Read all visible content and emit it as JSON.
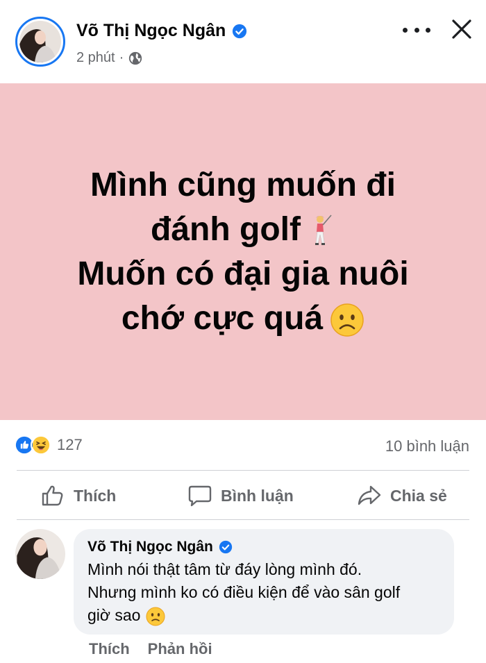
{
  "post": {
    "author": "Võ Thị Ngọc Ngân",
    "time": "2 phút",
    "separator": "·",
    "lines": [
      "Mình cũng muốn đi",
      "đánh golf",
      "Muốn có đại gia nuôi",
      "chớ cực quá"
    ],
    "background_color": "#f3c5c8"
  },
  "stats": {
    "reaction_count": "127",
    "comment_count": "10 bình luận"
  },
  "actions": {
    "like": "Thích",
    "comment": "Bình luận",
    "share": "Chia sẻ"
  },
  "comment": {
    "author": "Võ Thị Ngọc Ngân",
    "lines": [
      "Mình nói thật tâm từ đáy lòng mình đó.",
      "Nhưng mình ko có điều kiện để vào sân golf",
      "giờ sao"
    ],
    "like": "Thích",
    "reply": "Phản hồi"
  },
  "icons": [
    "verified-badge-icon",
    "globe-icon",
    "more-icon",
    "close-icon",
    "golfer-emoji-icon",
    "frowning-face-emoji-icon",
    "like-reaction-icon",
    "haha-reaction-icon",
    "thumbs-up-icon",
    "speech-bubble-icon",
    "share-arrow-icon",
    "slightly-frowning-face-emoji-icon"
  ],
  "colors": {
    "accent": "#1877f2",
    "secondary_text": "#65676b",
    "bubble": "#f0f2f5"
  }
}
